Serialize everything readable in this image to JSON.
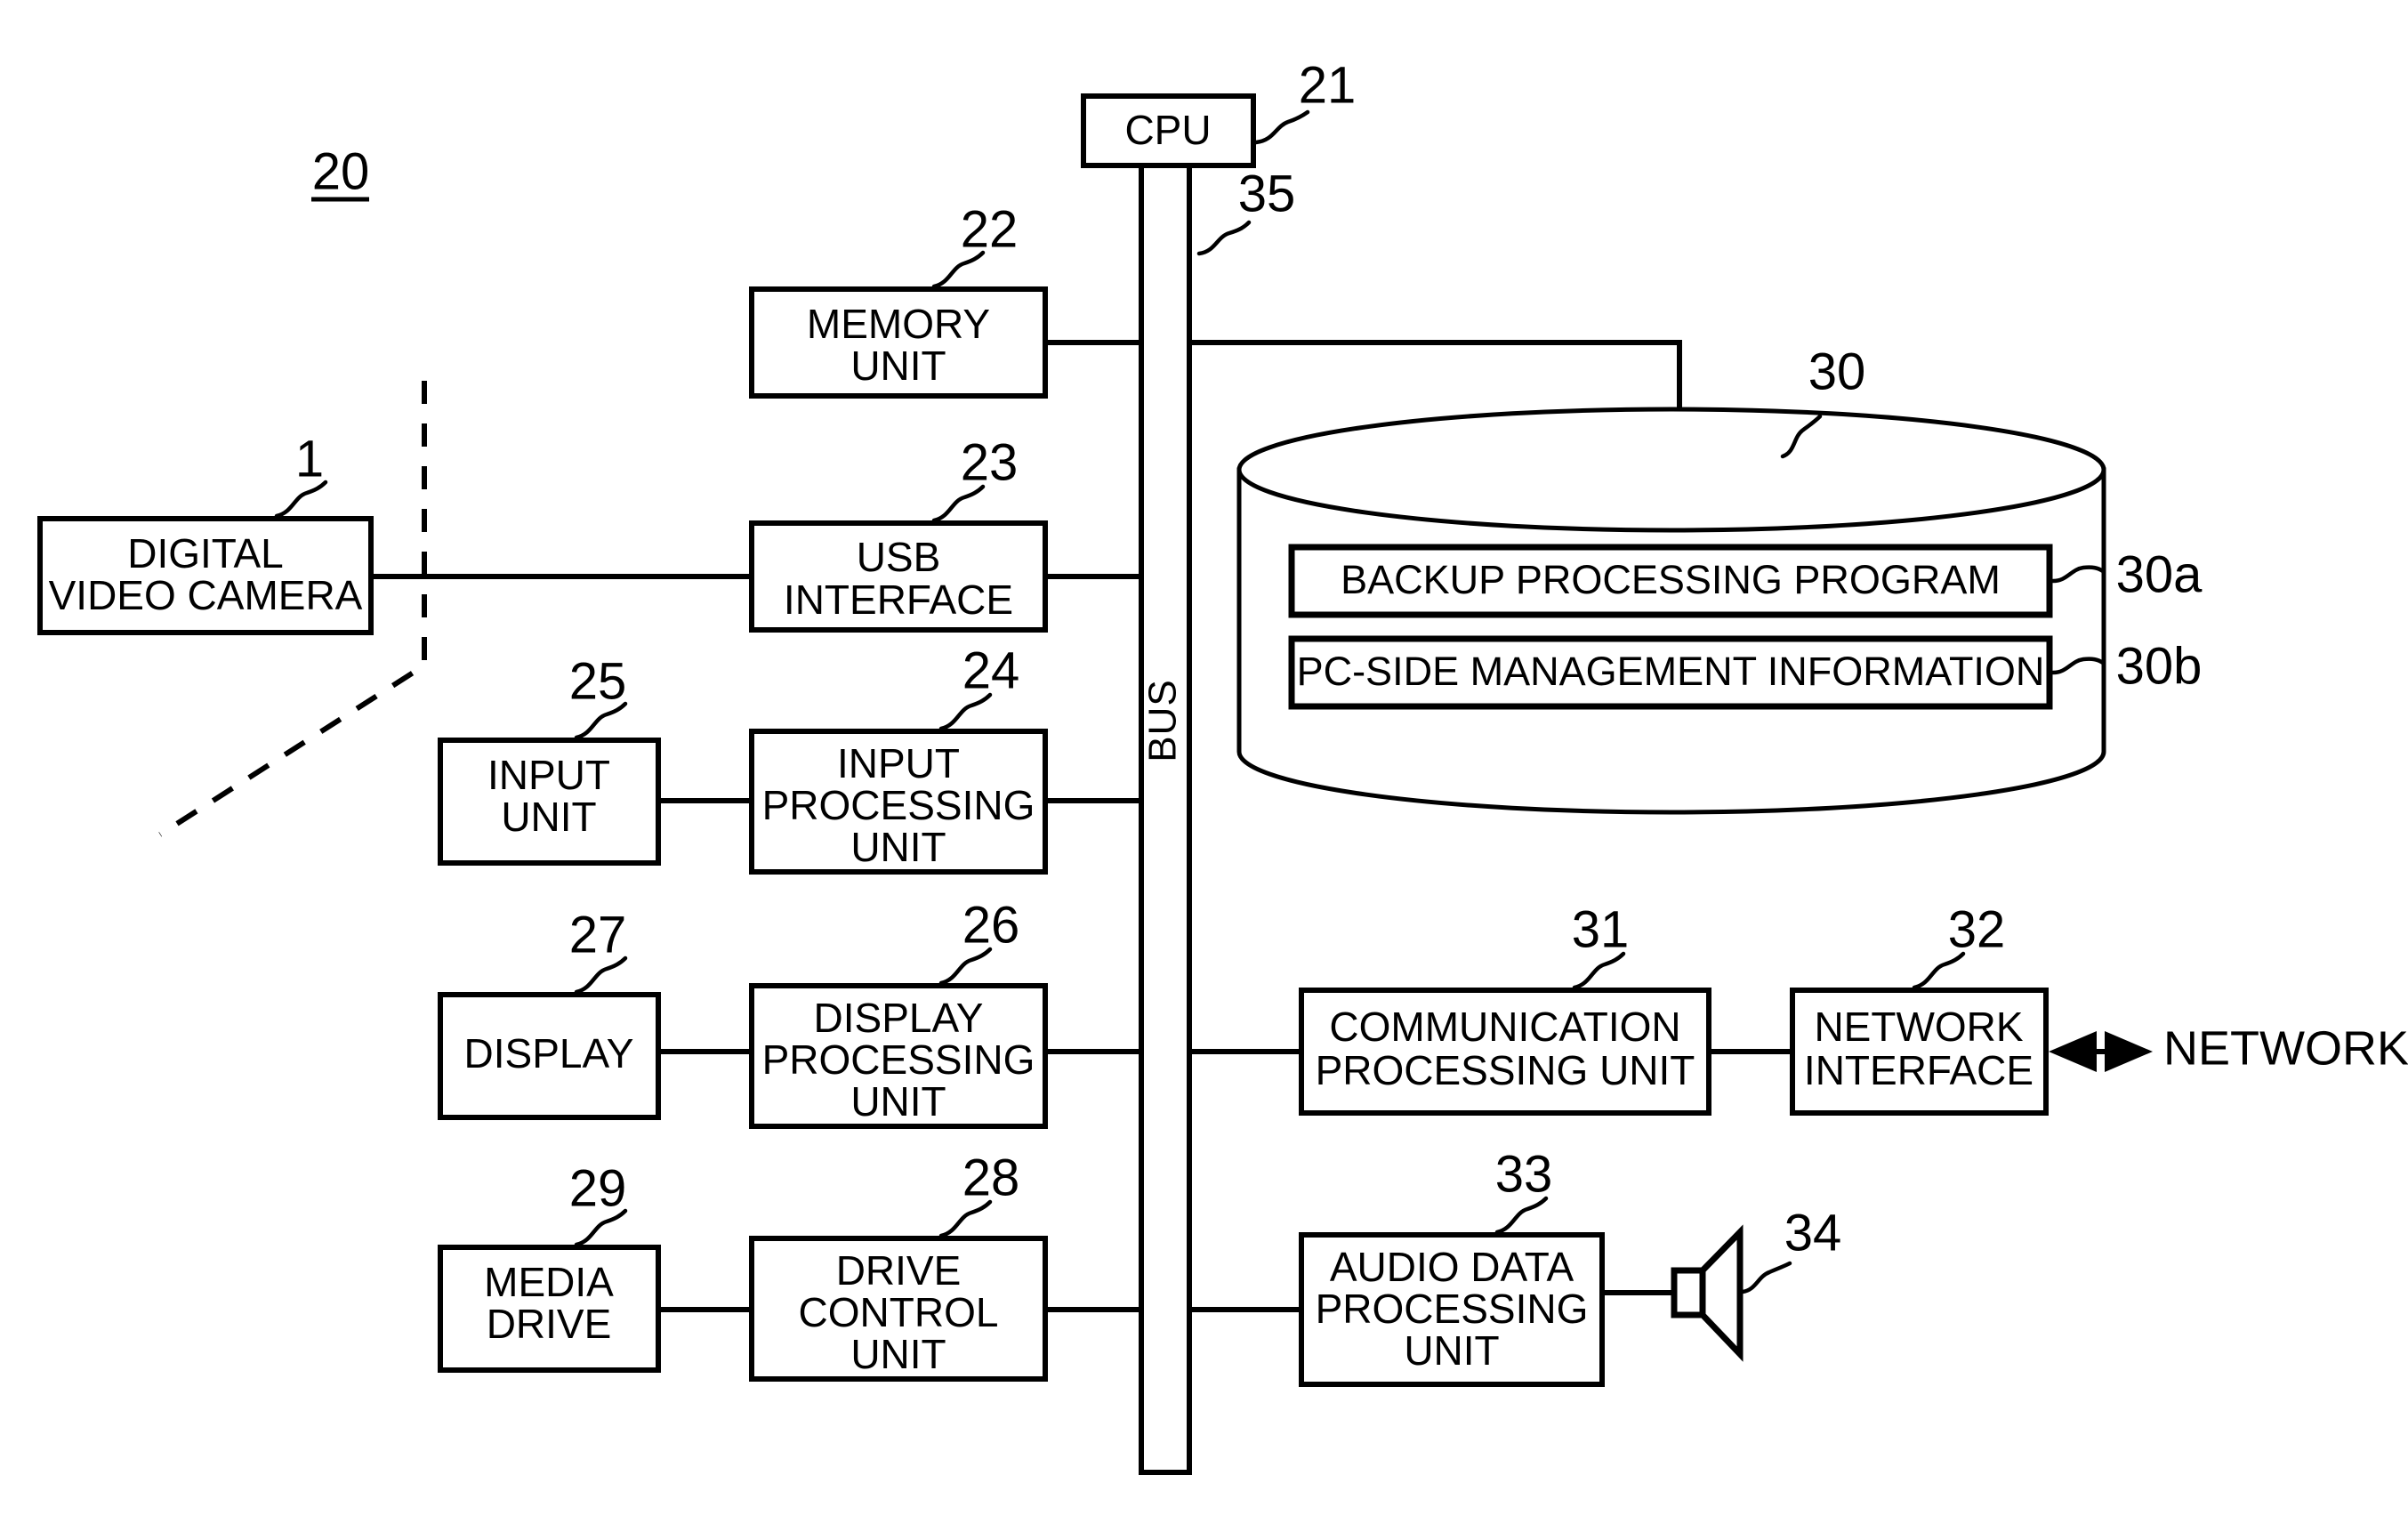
{
  "figure": {
    "reference_number": "20",
    "underlined": true
  },
  "blocks": {
    "cpu": {
      "label": "CPU",
      "ref": "21"
    },
    "memory_unit": {
      "line1": "MEMORY",
      "line2": "UNIT",
      "ref": "22"
    },
    "usb_interface": {
      "line1": "USB",
      "line2": "INTERFACE",
      "ref": "23"
    },
    "input_processing_unit": {
      "line1": "INPUT",
      "line2": "PROCESSING",
      "line3": "UNIT",
      "ref": "24"
    },
    "input_unit": {
      "line1": "INPUT",
      "line2": "UNIT",
      "ref": "25"
    },
    "display_processing_unit": {
      "line1": "DISPLAY",
      "line2": "PROCESSING",
      "line3": "UNIT",
      "ref": "26"
    },
    "display": {
      "label": "DISPLAY",
      "ref": "27"
    },
    "drive_control_unit": {
      "line1": "DRIVE",
      "line2": "CONTROL",
      "line3": "UNIT",
      "ref": "28"
    },
    "media_drive": {
      "line1": "MEDIA",
      "line2": "DRIVE",
      "ref": "29"
    },
    "digital_video_camera": {
      "line1": "DIGITAL",
      "line2": "VIDEO CAMERA",
      "ref": "1"
    },
    "communication_processing_unit": {
      "line1": "COMMUNICATION",
      "line2": "PROCESSING UNIT",
      "ref": "31"
    },
    "network_interface": {
      "line1": "NETWORK",
      "line2": "INTERFACE",
      "ref": "32"
    },
    "audio_data_processing_unit": {
      "line1": "AUDIO DATA",
      "line2": "PROCESSING",
      "line3": "UNIT",
      "ref": "33"
    },
    "speaker": {
      "ref": "34"
    }
  },
  "bus": {
    "label": "BUS",
    "ref": "35"
  },
  "storage": {
    "ref": "30",
    "items": [
      {
        "label": "BACKUP PROCESSING PROGRAM",
        "ref": "30a"
      },
      {
        "label": "PC-SIDE MANAGEMENT INFORMATION",
        "ref": "30b"
      }
    ]
  },
  "external": {
    "network_label": "NETWORK"
  },
  "colors": {
    "stroke": "#000000",
    "fill": "#ffffff"
  }
}
